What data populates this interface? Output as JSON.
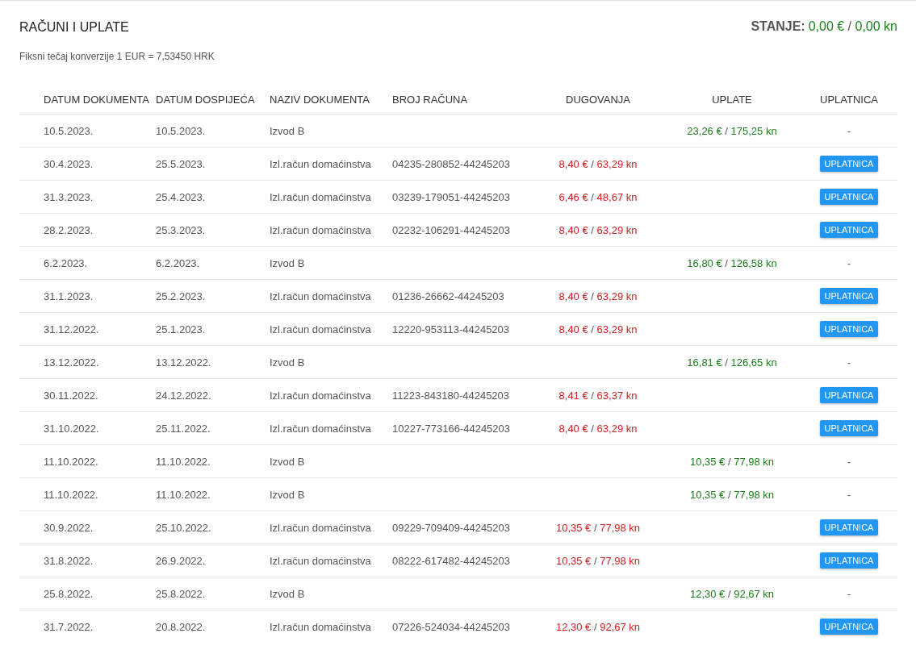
{
  "title": "RAČUNI I UPLATE",
  "balance": {
    "label": "STANJE:",
    "eur": "0,00 €",
    "sep": "/",
    "kn": "0,00 kn"
  },
  "subtitle": "Fiksni tečaj konverzije 1 EUR = 7,53450 HRK",
  "columns": [
    "DATUM DOKUMENTA",
    "DATUM DOSPIJEĆA",
    "NAZIV DOKUMENTA",
    "BROJ RAČUNA",
    "DUGOVANJA",
    "UPLATE",
    "UPLATNICA"
  ],
  "rows": [
    {
      "date": "10.5.2023.",
      "due": "10.5.2023.",
      "name": "Izvod B",
      "payment": {
        "eur": "23,26 €",
        "sep": "/",
        "kn": "175,25 kn"
      },
      "slip": {
        "kind": "dash",
        "label": "-"
      }
    },
    {
      "date": "30.4.2023.",
      "due": "25.5.2023.",
      "name": "Izl.račun domaćinstva",
      "account": "04235-280852-44245203",
      "debt": {
        "eur": "8,40 €",
        "sep": "/",
        "kn": "63,29 kn"
      },
      "slip": {
        "kind": "button",
        "label": "UPLATNICA"
      }
    },
    {
      "date": "31.3.2023.",
      "due": "25.4.2023.",
      "name": "Izl.račun domaćinstva",
      "account": "03239-179051-44245203",
      "debt": {
        "eur": "6,46 €",
        "sep": "/",
        "kn": "48,67 kn"
      },
      "slip": {
        "kind": "button",
        "label": "UPLATNICA"
      }
    },
    {
      "date": "28.2.2023.",
      "due": "25.3.2023.",
      "name": "Izl.račun domaćinstva",
      "account": "02232-106291-44245203",
      "debt": {
        "eur": "8,40 €",
        "sep": "/",
        "kn": "63,29 kn"
      },
      "slip": {
        "kind": "button",
        "label": "UPLATNICA"
      }
    },
    {
      "date": "6.2.2023.",
      "due": "6.2.2023.",
      "name": "Izvod B",
      "payment": {
        "eur": "16,80 €",
        "sep": "/",
        "kn": "126,58 kn"
      },
      "slip": {
        "kind": "dash",
        "label": "-"
      }
    },
    {
      "date": "31.1.2023.",
      "due": "25.2.2023.",
      "name": "Izl.račun domaćinstva",
      "account": "01236-26662-44245203",
      "debt": {
        "eur": "8,40 €",
        "sep": "/",
        "kn": "63,29 kn"
      },
      "slip": {
        "kind": "button",
        "label": "UPLATNICA"
      }
    },
    {
      "date": "31.12.2022.",
      "due": "25.1.2023.",
      "name": "Izl.račun domaćinstva",
      "account": "12220-953113-44245203",
      "debt": {
        "eur": "8,40 €",
        "sep": "/",
        "kn": "63,29 kn"
      },
      "slip": {
        "kind": "button",
        "label": "UPLATNICA"
      }
    },
    {
      "date": "13.12.2022.",
      "due": "13.12.2022.",
      "name": "Izvod B",
      "payment": {
        "eur": "16,81 €",
        "sep": "/",
        "kn": "126,65 kn"
      },
      "slip": {
        "kind": "dash",
        "label": "-"
      }
    },
    {
      "date": "30.11.2022.",
      "due": "24.12.2022.",
      "name": "Izl.račun domaćinstva",
      "account": "11223-843180-44245203",
      "debt": {
        "eur": "8,41 €",
        "sep": "/",
        "kn": "63,37 kn"
      },
      "slip": {
        "kind": "button",
        "label": "UPLATNICA"
      }
    },
    {
      "date": "31.10.2022.",
      "due": "25.11.2022.",
      "name": "Izl.račun domaćinstva",
      "account": "10227-773166-44245203",
      "debt": {
        "eur": "8,40 €",
        "sep": "/",
        "kn": "63,29 kn"
      },
      "slip": {
        "kind": "button",
        "label": "UPLATNICA"
      }
    },
    {
      "date": "11.10.2022.",
      "due": "11.10.2022.",
      "name": "Izvod B",
      "payment": {
        "eur": "10,35 €",
        "sep": "/",
        "kn": "77,98 kn"
      },
      "slip": {
        "kind": "dash",
        "label": "-"
      }
    },
    {
      "date": "11.10.2022.",
      "due": "11.10.2022.",
      "name": "Izvod B",
      "payment": {
        "eur": "10,35 €",
        "sep": "/",
        "kn": "77,98 kn"
      },
      "slip": {
        "kind": "dash",
        "label": "-"
      }
    },
    {
      "date": "30.9.2022.",
      "due": "25.10.2022.",
      "name": "Izl.račun domaćinstva",
      "account": "09229-709409-44245203",
      "debt": {
        "eur": "10,35 €",
        "sep": "/",
        "kn": "77,98 kn"
      },
      "slip": {
        "kind": "button",
        "label": "UPLATNICA"
      }
    },
    {
      "date": "31.8.2022.",
      "due": "26.9.2022.",
      "name": "Izl.račun domaćinstva",
      "account": "08222-617482-44245203",
      "debt": {
        "eur": "10,35 €",
        "sep": "/",
        "kn": "77,98 kn"
      },
      "slip": {
        "kind": "button",
        "label": "UPLATNICA"
      }
    },
    {
      "date": "25.8.2022.",
      "due": "25.8.2022.",
      "name": "Izvod B",
      "payment": {
        "eur": "12,30 €",
        "sep": "/",
        "kn": "92,67 kn"
      },
      "slip": {
        "kind": "dash",
        "label": "-"
      }
    },
    {
      "date": "31.7.2022.",
      "due": "20.8.2022.",
      "name": "Izl.račun domaćinstva",
      "account": "07226-524034-44245203",
      "debt": {
        "eur": "12,30 €",
        "sep": "/",
        "kn": "92,67 kn"
      },
      "slip": {
        "kind": "button",
        "label": "UPLATNICA"
      }
    }
  ]
}
